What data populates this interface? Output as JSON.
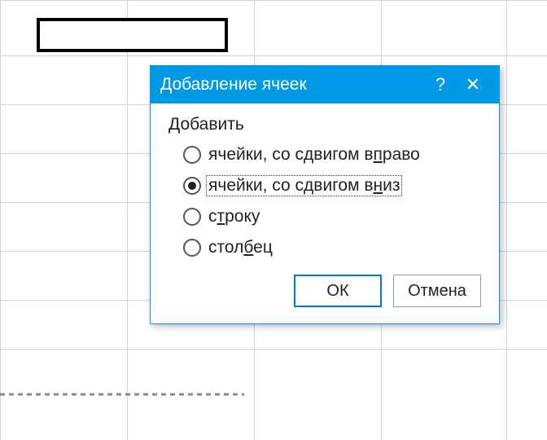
{
  "dialog": {
    "title": "Добавление ячеек",
    "help_symbol": "?",
    "close_symbol": "✕",
    "group_label": "Добавить",
    "options": [
      {
        "pre": "ячейки, со сдвигом в",
        "accel": "п",
        "post": "раво",
        "checked": false,
        "focused": false
      },
      {
        "pre": "ячейки, со сдвигом в",
        "accel": "н",
        "post": "из",
        "checked": true,
        "focused": true
      },
      {
        "pre": "с",
        "accel": "т",
        "post": "року",
        "checked": false,
        "focused": false
      },
      {
        "pre": "стол",
        "accel": "б",
        "post": "ец",
        "checked": false,
        "focused": false
      }
    ],
    "buttons": {
      "ok": "ОК",
      "cancel": "Отмена"
    }
  }
}
